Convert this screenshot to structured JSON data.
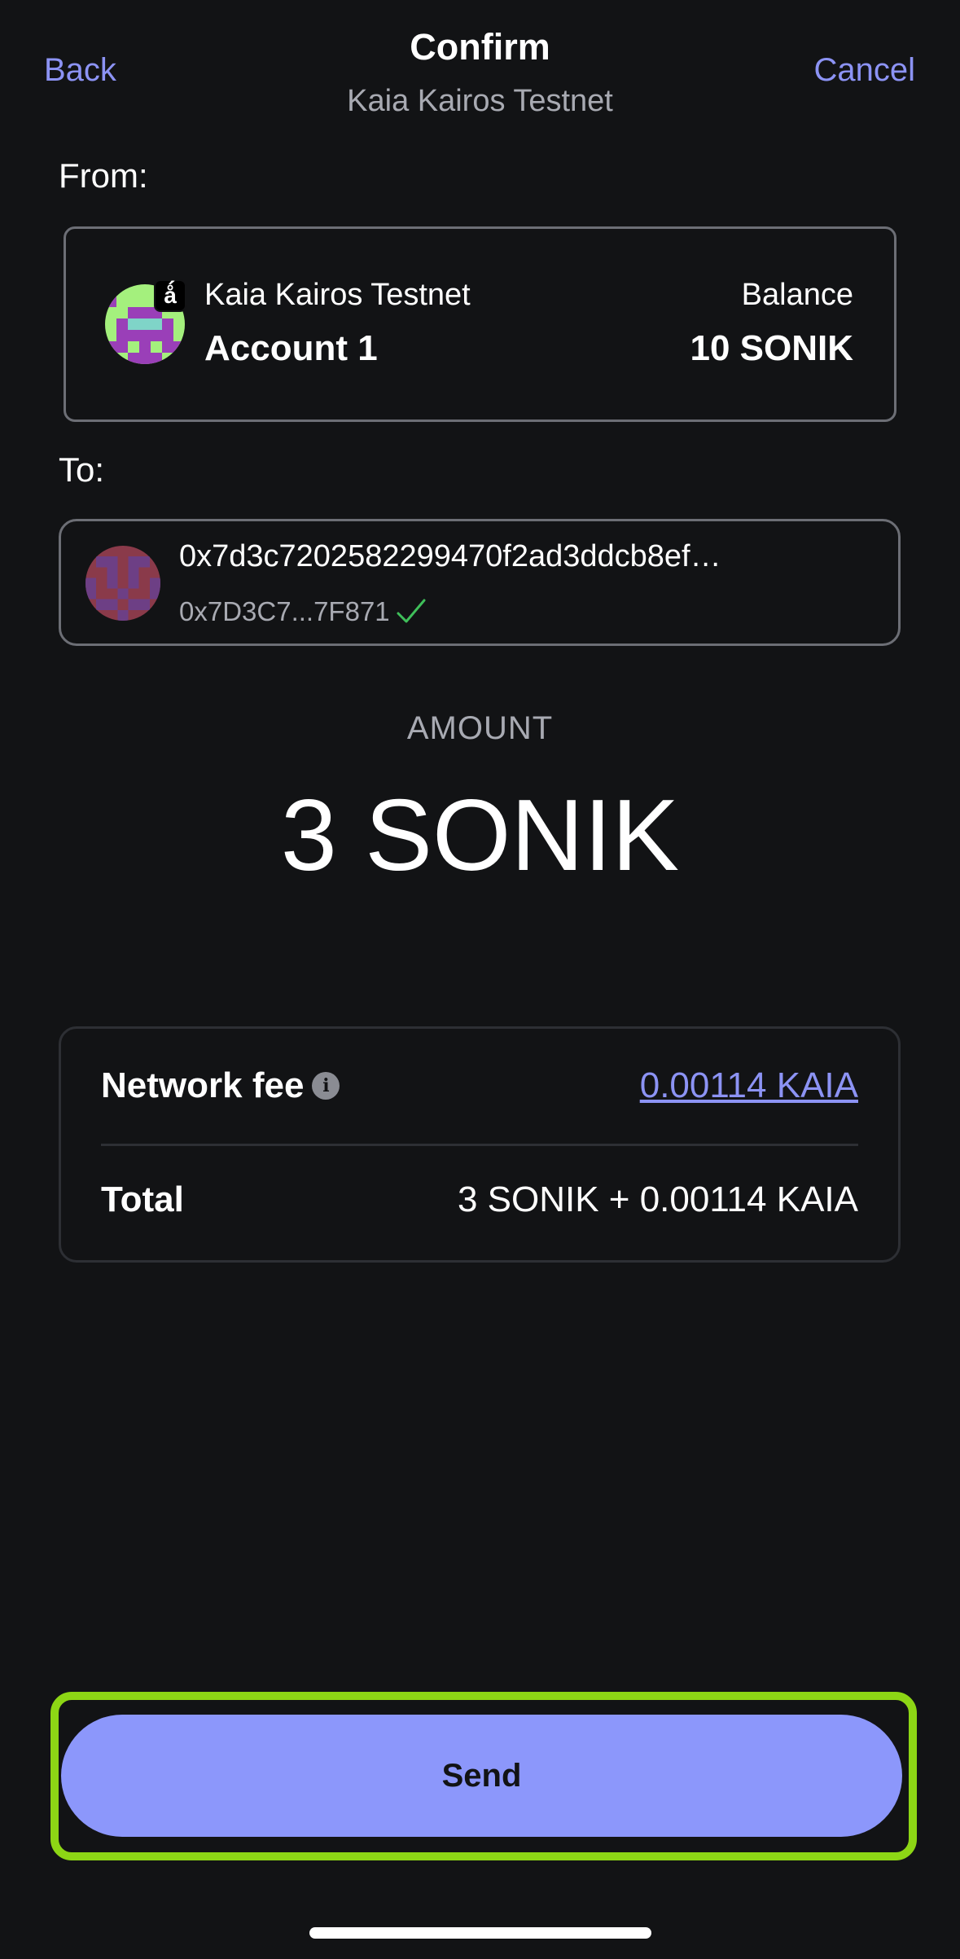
{
  "header": {
    "back_label": "Back",
    "cancel_label": "Cancel",
    "title": "Confirm",
    "subtitle": "Kaia Kairos Testnet"
  },
  "from": {
    "label": "From:",
    "network": "Kaia Kairos Testnet",
    "account": "Account 1",
    "balance_label": "Balance",
    "balance_value": "10 SONIK",
    "network_badge": "ǻ"
  },
  "to": {
    "label": "To:",
    "address_full": "0x7d3c7202582299470f2ad3ddcb8ef…",
    "address_short": "0x7D3C7...7F871"
  },
  "amount": {
    "label": "AMOUNT",
    "value": "3 SONIK"
  },
  "fees": {
    "network_fee_label": "Network fee",
    "network_fee_value": "0.00114 KAIA",
    "total_label": "Total",
    "total_value": "3 SONIK + 0.00114 KAIA"
  },
  "actions": {
    "send_label": "Send"
  },
  "colors": {
    "background": "#121315",
    "accent": "#8c93f4",
    "send_button": "#8c97fb",
    "highlight": "#8dd615",
    "verified_check": "#3fbf5a"
  },
  "icons": {
    "from_avatar": "pixel-avatar-green-purple",
    "to_avatar": "pixel-avatar-maroon",
    "verified": "check-icon",
    "info": "info-icon"
  }
}
